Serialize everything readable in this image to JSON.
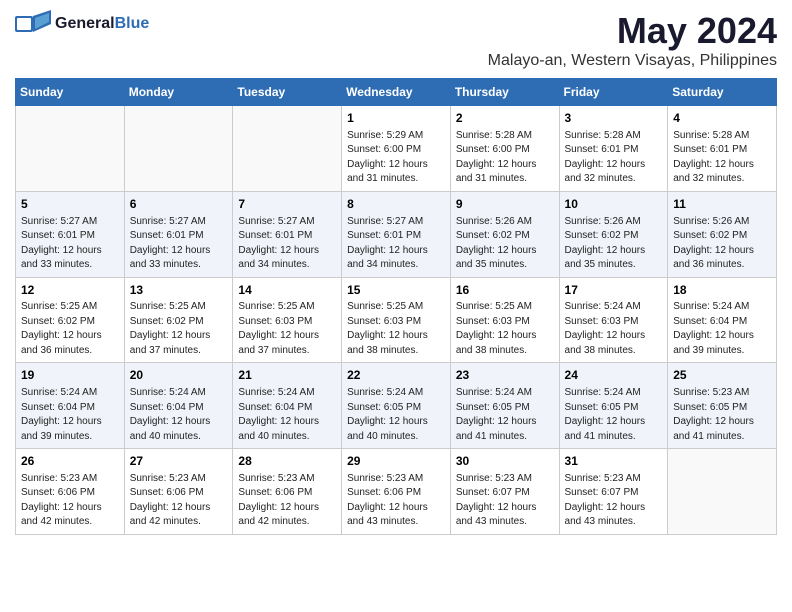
{
  "logo": {
    "part1": "General",
    "part2": "Blue"
  },
  "title": "May 2024",
  "subtitle": "Malayo-an, Western Visayas, Philippines",
  "headers": [
    "Sunday",
    "Monday",
    "Tuesday",
    "Wednesday",
    "Thursday",
    "Friday",
    "Saturday"
  ],
  "weeks": [
    [
      {
        "day": "",
        "info": ""
      },
      {
        "day": "",
        "info": ""
      },
      {
        "day": "",
        "info": ""
      },
      {
        "day": "1",
        "info": "Sunrise: 5:29 AM\nSunset: 6:00 PM\nDaylight: 12 hours\nand 31 minutes."
      },
      {
        "day": "2",
        "info": "Sunrise: 5:28 AM\nSunset: 6:00 PM\nDaylight: 12 hours\nand 31 minutes."
      },
      {
        "day": "3",
        "info": "Sunrise: 5:28 AM\nSunset: 6:01 PM\nDaylight: 12 hours\nand 32 minutes."
      },
      {
        "day": "4",
        "info": "Sunrise: 5:28 AM\nSunset: 6:01 PM\nDaylight: 12 hours\nand 32 minutes."
      }
    ],
    [
      {
        "day": "5",
        "info": "Sunrise: 5:27 AM\nSunset: 6:01 PM\nDaylight: 12 hours\nand 33 minutes."
      },
      {
        "day": "6",
        "info": "Sunrise: 5:27 AM\nSunset: 6:01 PM\nDaylight: 12 hours\nand 33 minutes."
      },
      {
        "day": "7",
        "info": "Sunrise: 5:27 AM\nSunset: 6:01 PM\nDaylight: 12 hours\nand 34 minutes."
      },
      {
        "day": "8",
        "info": "Sunrise: 5:27 AM\nSunset: 6:01 PM\nDaylight: 12 hours\nand 34 minutes."
      },
      {
        "day": "9",
        "info": "Sunrise: 5:26 AM\nSunset: 6:02 PM\nDaylight: 12 hours\nand 35 minutes."
      },
      {
        "day": "10",
        "info": "Sunrise: 5:26 AM\nSunset: 6:02 PM\nDaylight: 12 hours\nand 35 minutes."
      },
      {
        "day": "11",
        "info": "Sunrise: 5:26 AM\nSunset: 6:02 PM\nDaylight: 12 hours\nand 36 minutes."
      }
    ],
    [
      {
        "day": "12",
        "info": "Sunrise: 5:25 AM\nSunset: 6:02 PM\nDaylight: 12 hours\nand 36 minutes."
      },
      {
        "day": "13",
        "info": "Sunrise: 5:25 AM\nSunset: 6:02 PM\nDaylight: 12 hours\nand 37 minutes."
      },
      {
        "day": "14",
        "info": "Sunrise: 5:25 AM\nSunset: 6:03 PM\nDaylight: 12 hours\nand 37 minutes."
      },
      {
        "day": "15",
        "info": "Sunrise: 5:25 AM\nSunset: 6:03 PM\nDaylight: 12 hours\nand 38 minutes."
      },
      {
        "day": "16",
        "info": "Sunrise: 5:25 AM\nSunset: 6:03 PM\nDaylight: 12 hours\nand 38 minutes."
      },
      {
        "day": "17",
        "info": "Sunrise: 5:24 AM\nSunset: 6:03 PM\nDaylight: 12 hours\nand 38 minutes."
      },
      {
        "day": "18",
        "info": "Sunrise: 5:24 AM\nSunset: 6:04 PM\nDaylight: 12 hours\nand 39 minutes."
      }
    ],
    [
      {
        "day": "19",
        "info": "Sunrise: 5:24 AM\nSunset: 6:04 PM\nDaylight: 12 hours\nand 39 minutes."
      },
      {
        "day": "20",
        "info": "Sunrise: 5:24 AM\nSunset: 6:04 PM\nDaylight: 12 hours\nand 40 minutes."
      },
      {
        "day": "21",
        "info": "Sunrise: 5:24 AM\nSunset: 6:04 PM\nDaylight: 12 hours\nand 40 minutes."
      },
      {
        "day": "22",
        "info": "Sunrise: 5:24 AM\nSunset: 6:05 PM\nDaylight: 12 hours\nand 40 minutes."
      },
      {
        "day": "23",
        "info": "Sunrise: 5:24 AM\nSunset: 6:05 PM\nDaylight: 12 hours\nand 41 minutes."
      },
      {
        "day": "24",
        "info": "Sunrise: 5:24 AM\nSunset: 6:05 PM\nDaylight: 12 hours\nand 41 minutes."
      },
      {
        "day": "25",
        "info": "Sunrise: 5:23 AM\nSunset: 6:05 PM\nDaylight: 12 hours\nand 41 minutes."
      }
    ],
    [
      {
        "day": "26",
        "info": "Sunrise: 5:23 AM\nSunset: 6:06 PM\nDaylight: 12 hours\nand 42 minutes."
      },
      {
        "day": "27",
        "info": "Sunrise: 5:23 AM\nSunset: 6:06 PM\nDaylight: 12 hours\nand 42 minutes."
      },
      {
        "day": "28",
        "info": "Sunrise: 5:23 AM\nSunset: 6:06 PM\nDaylight: 12 hours\nand 42 minutes."
      },
      {
        "day": "29",
        "info": "Sunrise: 5:23 AM\nSunset: 6:06 PM\nDaylight: 12 hours\nand 43 minutes."
      },
      {
        "day": "30",
        "info": "Sunrise: 5:23 AM\nSunset: 6:07 PM\nDaylight: 12 hours\nand 43 minutes."
      },
      {
        "day": "31",
        "info": "Sunrise: 5:23 AM\nSunset: 6:07 PM\nDaylight: 12 hours\nand 43 minutes."
      },
      {
        "day": "",
        "info": ""
      }
    ]
  ]
}
